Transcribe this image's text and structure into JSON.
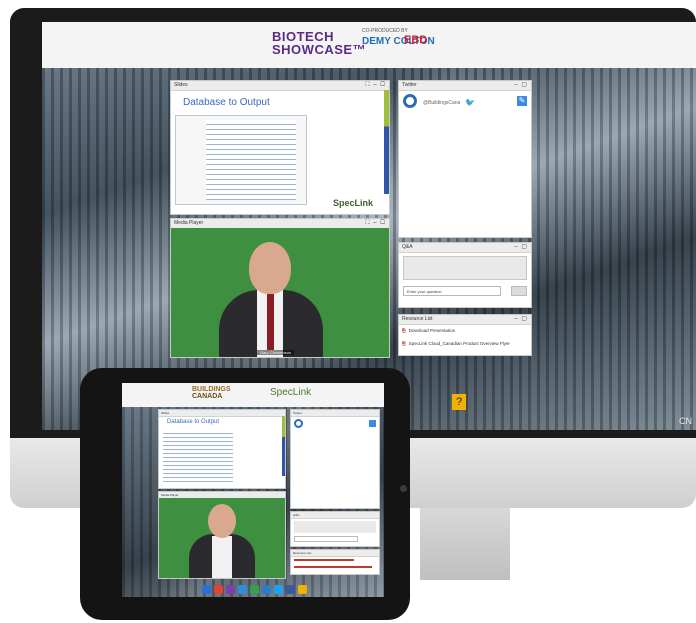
{
  "monitor": {
    "brand_line1": "BIOTECH",
    "brand_line2": "SHOWCASE™",
    "coproduced": "CO-PRODUCED BY",
    "demy": "DEMY COLTON",
    "ebd": "EBD",
    "slides_panel": {
      "title": "Slides",
      "heading": "Database to Output",
      "logo": "SpecLink"
    },
    "media_panel": {
      "title": "Media Player",
      "caption": "Gary Christenson"
    },
    "twitter_panel": {
      "title": "Twitter",
      "handle": "@BuildingsCana"
    },
    "qa_panel": {
      "title": "Q&A",
      "placeholder": "Enter your question",
      "submit": ""
    },
    "resources_panel": {
      "title": "Resource List",
      "items": [
        {
          "label": "Download Presentation"
        },
        {
          "label": "SpecLink Cloud_Canadian Product Overview Flyer"
        }
      ]
    },
    "help_label": "?",
    "corner_logo": "CN"
  },
  "tablet": {
    "brand_line1": "BUILDINGS",
    "brand_line2": "CANADA",
    "speclink": "SpecLink",
    "slides_title": "Slides",
    "slides_heading": "Database to Output",
    "twitter_title": "Twitter",
    "media_title": "Media Player",
    "qa_title": "Q&A",
    "resources_title": "Resource List"
  },
  "colors": {
    "brand_purple": "#5b2a86",
    "slide_heading_blue": "#3b6bb8",
    "video_green": "#3e8f3f",
    "help_yellow": "#f0b400"
  }
}
